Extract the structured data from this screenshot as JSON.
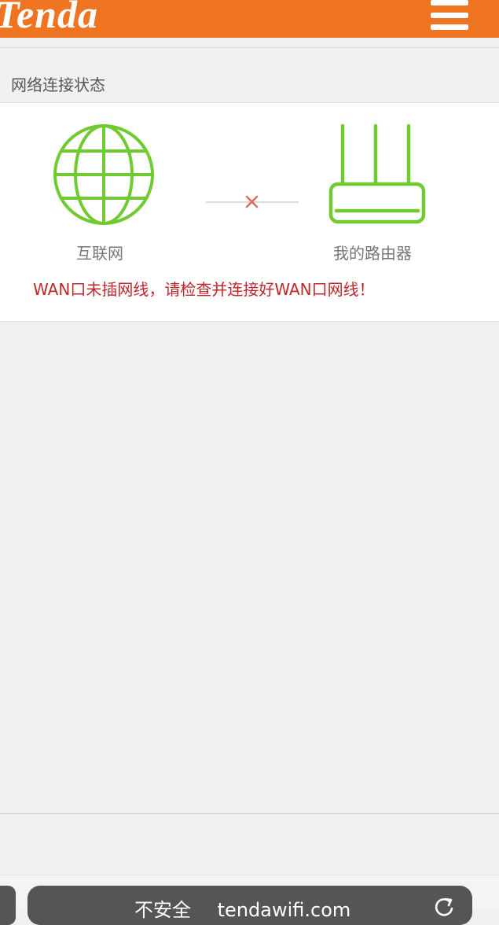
{
  "header": {
    "brand": "Tenda",
    "menu_icon": "hamburger-menu-icon",
    "color": "#ee7422"
  },
  "status": {
    "title": "网络连接状态",
    "internet_label": "互联网",
    "router_label": "我的路由器",
    "disconnected_icon": "x-mark-icon",
    "warning": "WAN口未插网线，请检查并连接好WAN口网线！",
    "icon_color": "#6fcb2f",
    "warning_color": "#c0262c"
  },
  "browser": {
    "address_text": "tendawifi.com",
    "security_label": "不安全",
    "reload_icon": "reload-icon"
  }
}
